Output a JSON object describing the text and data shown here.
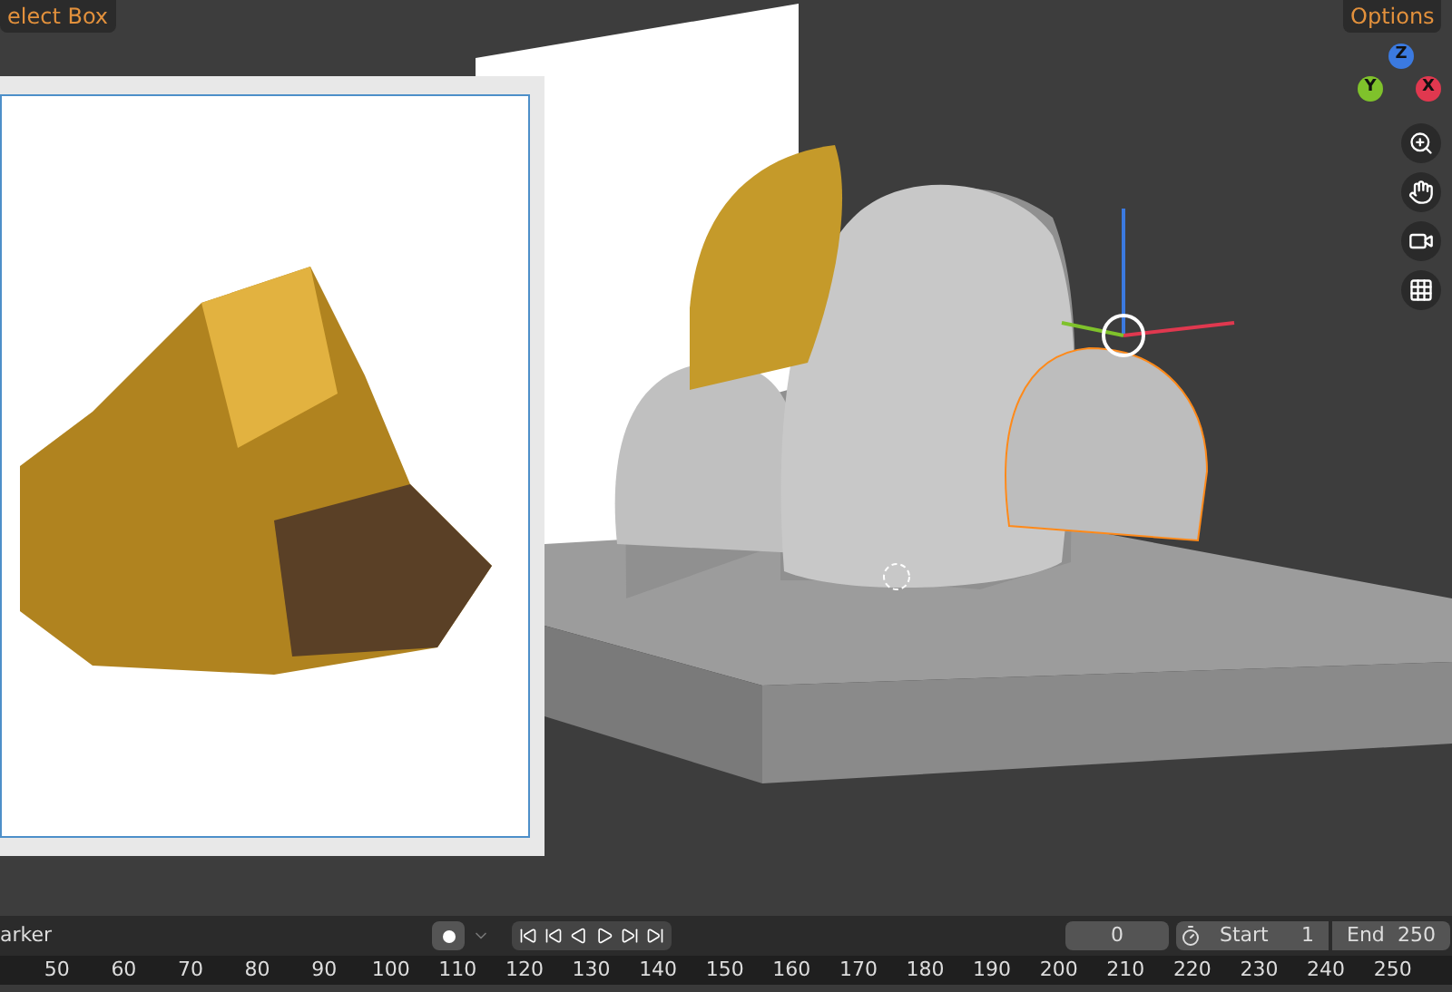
{
  "header": {
    "select_tool": "elect Box",
    "options": "Options"
  },
  "gizmo": {
    "axes": [
      {
        "label": "Z",
        "color": "#3b7ae0"
      },
      {
        "label": "Y",
        "color": "#7fc22b"
      },
      {
        "label": "X",
        "color": "#e0384f"
      }
    ]
  },
  "timeline": {
    "marker_menu": "arker",
    "current_frame": "0",
    "start": {
      "label": "Start",
      "value": "1"
    },
    "end": {
      "label": "End",
      "value": "250"
    },
    "ruler": [
      "50",
      "60",
      "70",
      "80",
      "90",
      "100",
      "110",
      "120",
      "130",
      "140",
      "150",
      "160",
      "170",
      "180",
      "190",
      "200",
      "210",
      "220",
      "230",
      "240",
      "250"
    ]
  }
}
